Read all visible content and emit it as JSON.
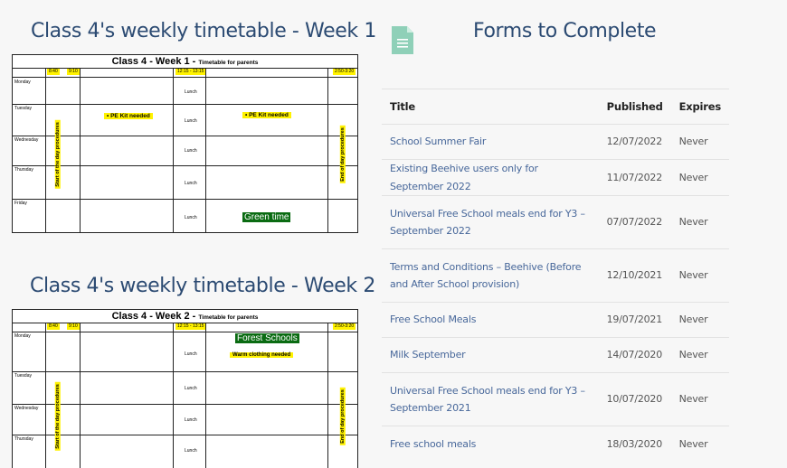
{
  "week1": {
    "heading": "Class 4's weekly timetable - Week 1",
    "title": "Class 4 - Week 1 -",
    "subtitle": "Timetable for parents",
    "times": [
      "8:40",
      "9:10",
      "12:15 - 13:15",
      "2:50-3:20"
    ],
    "days": [
      "Monday",
      "Tuesday",
      "Wednesday",
      "Thursday",
      "Friday"
    ],
    "lunch": "Lunch",
    "start_label": "Start of the day procedures",
    "end_label": "End of day procedures",
    "pe_note": "PE Kit needed",
    "green_time": "Green time"
  },
  "week2": {
    "heading": "Class 4's weekly timetable - Week 2",
    "title": "Class 4 - Week 2 -",
    "subtitle": "Timetable for parents",
    "times": [
      "8:40",
      "9:10",
      "12:15 - 13:15",
      "2:50-3:20"
    ],
    "days": [
      "Monday",
      "Tuesday",
      "Wednesday",
      "Thursday"
    ],
    "lunch": "Lunch",
    "start_label": "Start of the day procedures",
    "end_label": "End of day procedures",
    "forest": "Forest Schools",
    "clothing": "Warm clothing needed"
  },
  "forms": {
    "heading": "Forms to Complete",
    "icon": "document-icon",
    "icon_color": "#8fd0b8",
    "columns": [
      "Title",
      "Published",
      "Expires"
    ],
    "rows": [
      {
        "title": "School Summer Fair",
        "published": "12/07/2022",
        "expires": "Never"
      },
      {
        "title": "Existing Beehive users only for September 2022",
        "published": "11/07/2022",
        "expires": "Never"
      },
      {
        "title": "Universal Free School meals end for Y3 – September 2022",
        "published": "07/07/2022",
        "expires": "Never"
      },
      {
        "title": "Terms and Conditions – Beehive (Before and After School provision)",
        "published": "12/10/2021",
        "expires": "Never"
      },
      {
        "title": "Free School Meals",
        "published": "19/07/2021",
        "expires": "Never"
      },
      {
        "title": "Milk September",
        "published": "14/07/2020",
        "expires": "Never"
      },
      {
        "title": "Universal Free School meals end for Y3 – September 2021",
        "published": "10/07/2020",
        "expires": "Never"
      },
      {
        "title": "Free school meals",
        "published": "18/03/2020",
        "expires": "Never"
      }
    ]
  }
}
